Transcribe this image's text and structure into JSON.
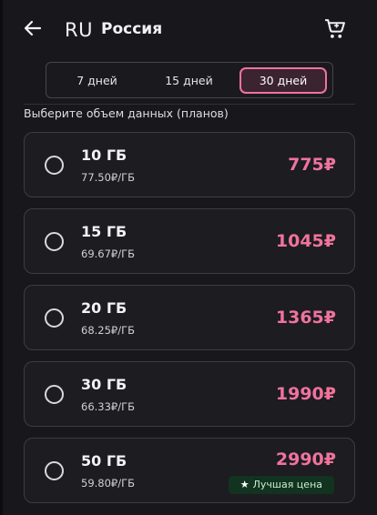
{
  "header": {
    "back_icon": "arrow-left-icon",
    "country_code": "RU",
    "country_name": "Россия",
    "cart_icon": "shopping-cart-icon"
  },
  "tabs": [
    {
      "label": "7 дней",
      "selected": false
    },
    {
      "label": "15 дней",
      "selected": false
    },
    {
      "label": "30 дней",
      "selected": true
    }
  ],
  "section_label": "Выберите объем данных (планов)",
  "plans": [
    {
      "amount": "10 ГБ",
      "per_gb": "77.50₽/ГБ",
      "price": "775₽"
    },
    {
      "amount": "15 ГБ",
      "per_gb": "69.67₽/ГБ",
      "price": "1045₽"
    },
    {
      "amount": "20 ГБ",
      "per_gb": "68.25₽/ГБ",
      "price": "1365₽"
    },
    {
      "amount": "30 ГБ",
      "per_gb": "66.33₽/ГБ",
      "price": "1990₽"
    },
    {
      "amount": "50 ГБ",
      "per_gb": "59.80₽/ГБ",
      "price": "2990₽",
      "badge": "Лучшая цена",
      "badge_icon": "star-icon"
    }
  ],
  "colors": {
    "background": "#18181c",
    "accent": "#f0739c",
    "badge_bg": "#12331f",
    "badge_text": "#c7f0d0"
  }
}
